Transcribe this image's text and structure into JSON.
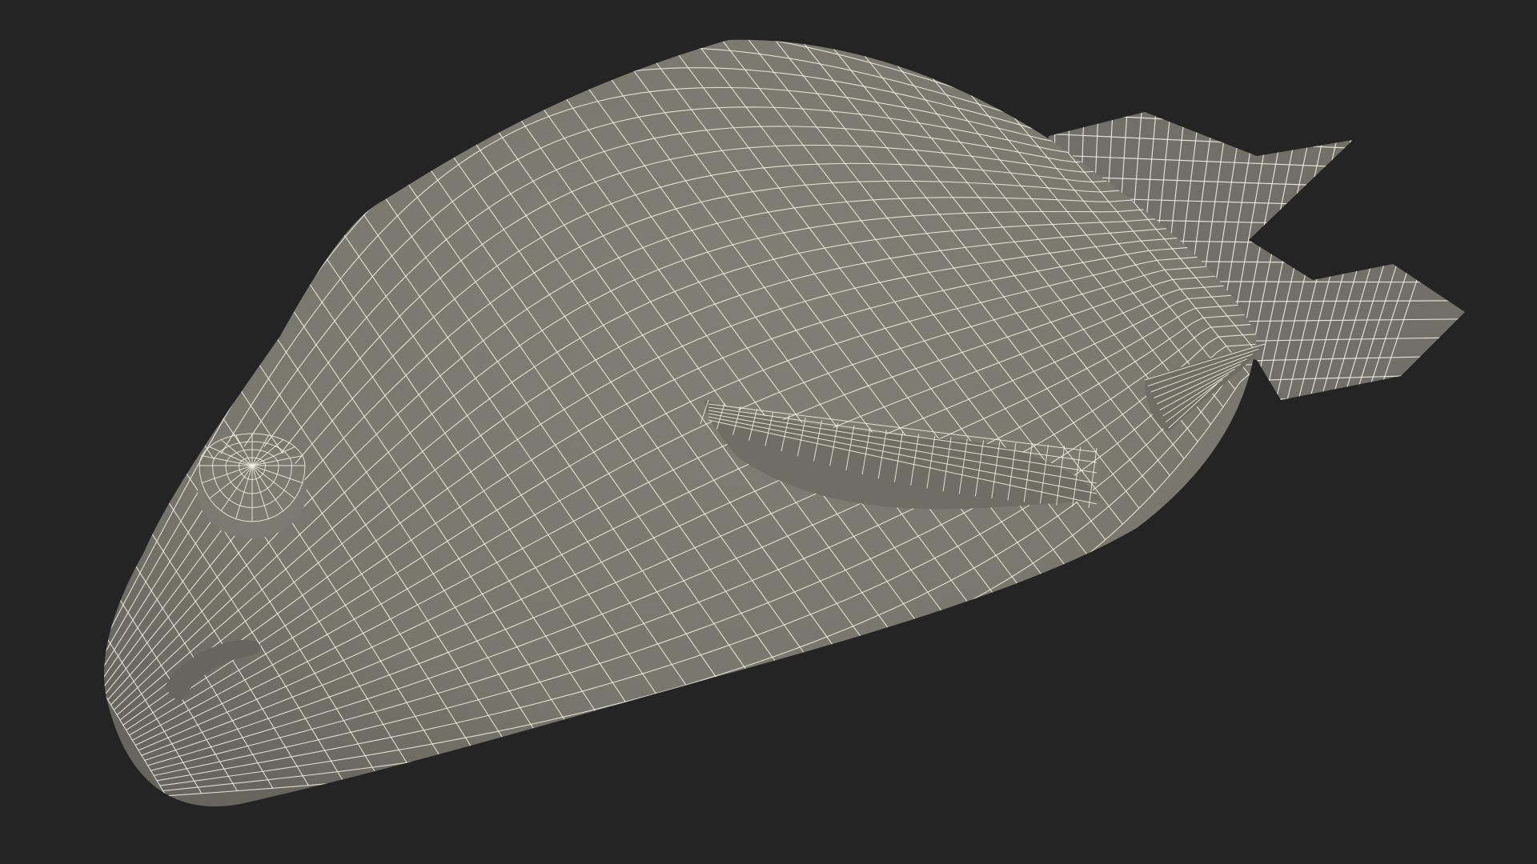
{
  "scene": {
    "background_color": "#242424",
    "surface_color": "#78786e",
    "surface_shadow_color": "#5f5f57",
    "surface_light_color": "#86867c",
    "wire_color": "#f2f2e6"
  },
  "icons": {
    "eye": "eye-icon",
    "flipper": "flipper-icon",
    "tail": "tail-fin-icon",
    "mouth": "mouth-icon"
  }
}
